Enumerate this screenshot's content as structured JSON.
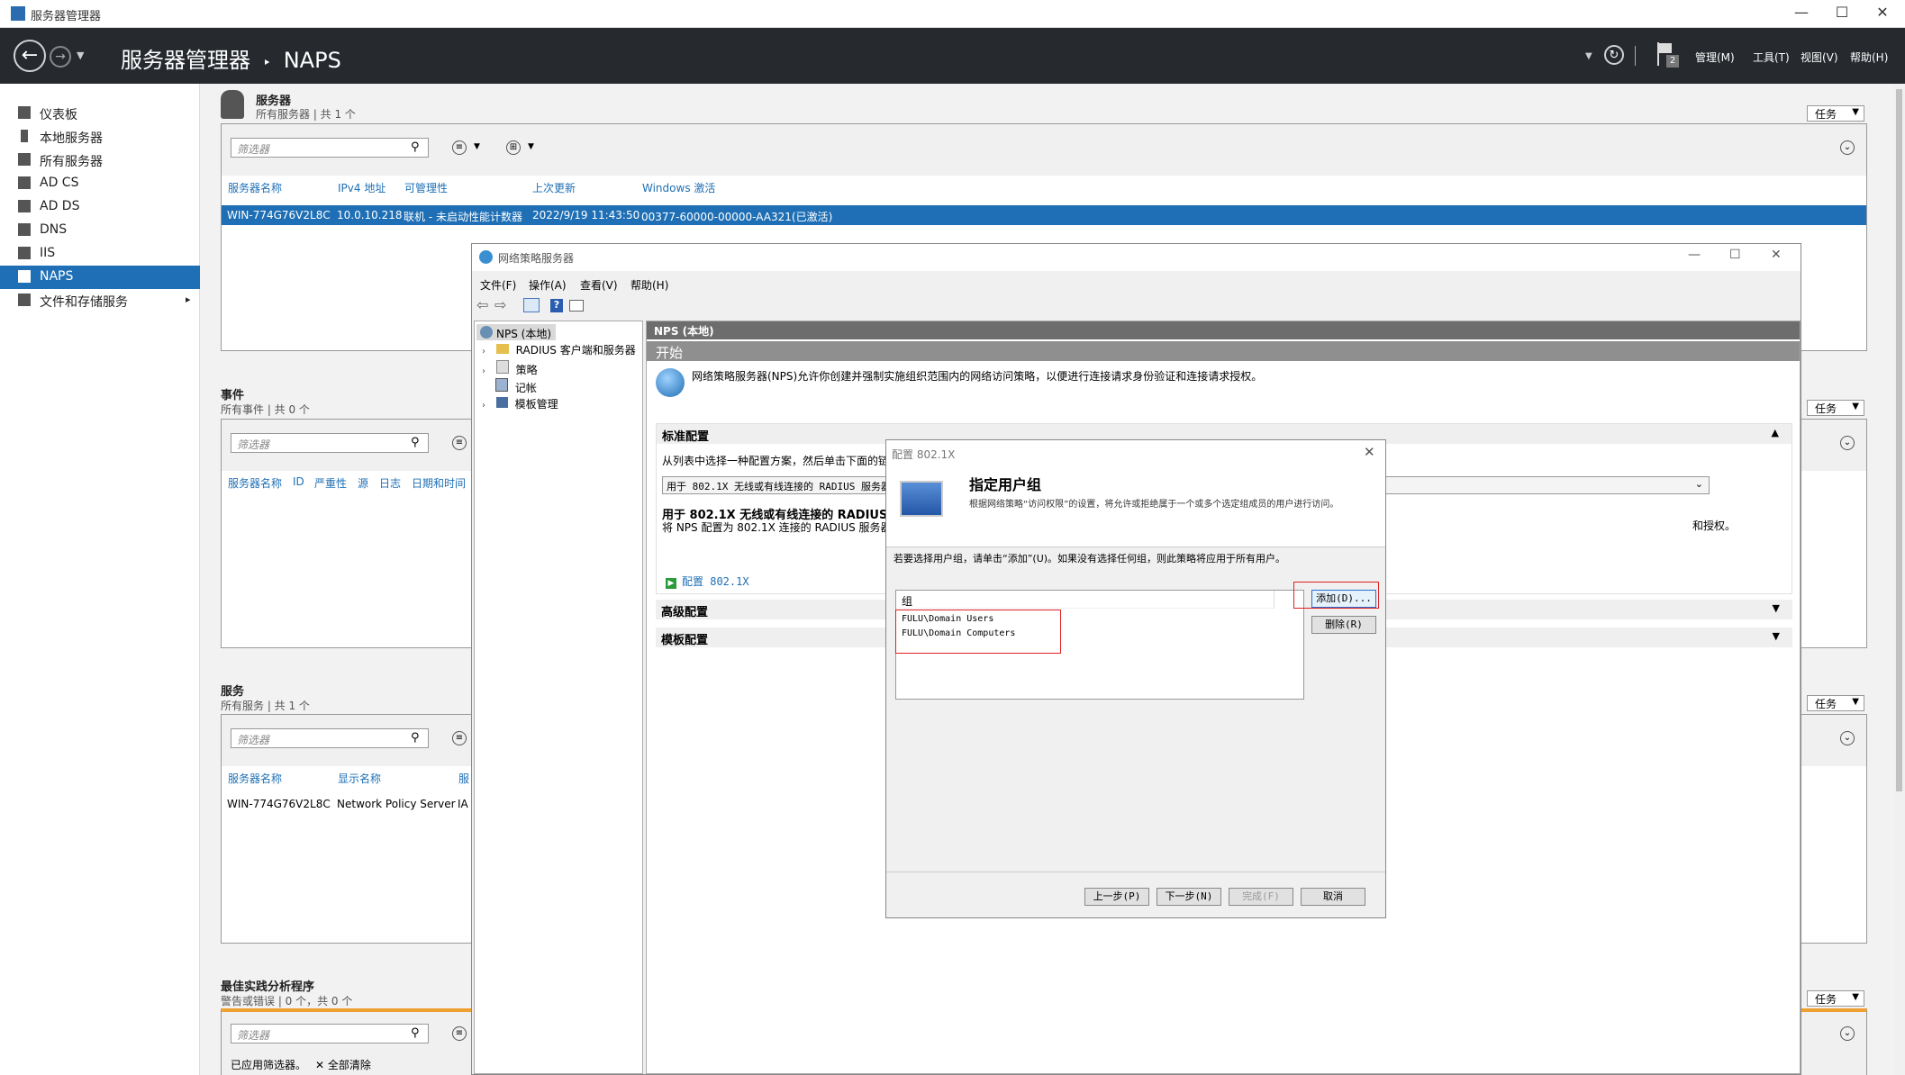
{
  "window": {
    "title": "服务器管理器",
    "min": "—",
    "max": "☐",
    "close": "✕"
  },
  "topbar": {
    "breadcrumb_root": "服务器管理器",
    "breadcrumb_sep": "‣",
    "breadcrumb_current": "NAPS",
    "flag_badge": "2",
    "menus": [
      "管理(M)",
      "工具(T)",
      "视图(V)",
      "帮助(H)"
    ]
  },
  "sidebar": {
    "items": [
      {
        "label": "仪表板"
      },
      {
        "label": "本地服务器"
      },
      {
        "label": "所有服务器"
      },
      {
        "label": "AD CS"
      },
      {
        "label": "AD DS"
      },
      {
        "label": "DNS"
      },
      {
        "label": "IIS"
      },
      {
        "label": "NAPS"
      },
      {
        "label": "文件和存储服务"
      }
    ],
    "expand_arrow": "▸"
  },
  "servers": {
    "title": "服务器",
    "subtitle": "所有服务器 | 共 1 个",
    "tasks": "任务",
    "filter_placeholder": "筛选器",
    "columns": [
      "服务器名称",
      "IPv4 地址",
      "可管理性",
      "上次更新",
      "Windows 激活"
    ],
    "row": [
      "WIN-774G76V2L8C",
      "10.0.10.218",
      "联机 - 未启动性能计数器",
      "2022/9/19 11:43:50",
      "00377-60000-00000-AA321(已激活)"
    ]
  },
  "events": {
    "title": "事件",
    "subtitle": "所有事件 | 共 0 个",
    "tasks": "任务",
    "filter_placeholder": "筛选器",
    "columns": [
      "服务器名称",
      "ID",
      "严重性",
      "源",
      "日志",
      "日期和时间"
    ]
  },
  "services": {
    "title": "服务",
    "subtitle": "所有服务 | 共 1 个",
    "tasks": "任务",
    "filter_placeholder": "筛选器",
    "columns": [
      "服务器名称",
      "显示名称",
      "服"
    ],
    "row": [
      "WIN-774G76V2L8C",
      "Network Policy Server",
      "IA"
    ]
  },
  "bpa": {
    "title": "最佳实践分析程序",
    "subtitle": "警告或错误 | 0 个，共 0 个",
    "tasks": "任务",
    "filter_placeholder": "筛选器",
    "applied": "已应用筛选器。",
    "clear_all": "全部清除"
  },
  "nps": {
    "title": "网络策略服务器",
    "menus": [
      "文件(F)",
      "操作(A)",
      "查看(V)",
      "帮助(H)"
    ],
    "tree": {
      "root": "NPS (本地)",
      "items": [
        "RADIUS 客户端和服务器",
        "策略",
        "记帐",
        "模板管理"
      ]
    },
    "content_header": "NPS (本地)",
    "start": "开始",
    "intro": "网络策略服务器(NPS)允许你创建并强制实施组织范围内的网络访问策略，以便进行连接请求身份验证和连接请求授权。",
    "standard_config": "标准配置",
    "standard_desc": "从列表中选择一种配置方案，然后单击下面的链",
    "select_value": "用于 802.1X 无线或有线连接的 RADIUS 服务器",
    "bold_title": "用于 802.1X 无线或有线连接的 RADIUS 服",
    "bold_desc": "将 NPS 配置为 802.1X 连接的 RADIUS 服务器时",
    "tail_desc": "和授权。",
    "config_link": "配置 802.1X",
    "advanced_config": "高级配置",
    "template_config": "模板配置"
  },
  "dialog": {
    "title": "配置 802.1X",
    "heading": "指定用户组",
    "desc": "根据网络策略“访问权限”的设置，将允许或拒绝属于一个或多个选定组成员的用户进行访问。",
    "instruction": "若要选择用户组，请单击“添加”(U)。如果没有选择任何组，则此策略将应用于所有用户。",
    "group_header": "组",
    "groups": [
      "FULU\\Domain Users",
      "FULU\\Domain Computers"
    ],
    "add": "添加(D)...",
    "remove": "删除(R)",
    "prev": "上一步(P)",
    "next": "下一步(N)",
    "finish": "完成(F)",
    "cancel": "取消"
  }
}
